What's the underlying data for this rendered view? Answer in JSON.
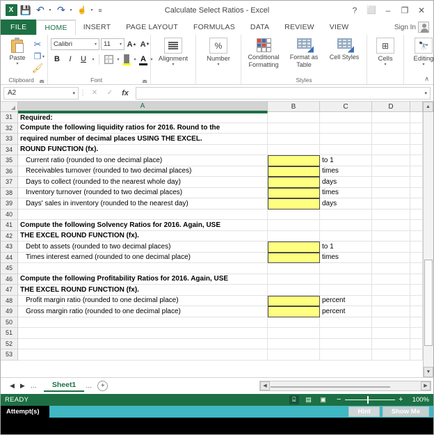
{
  "window": {
    "title": "Calculate Select Ratios - Excel",
    "quick_access": [
      {
        "name": "excel-logo",
        "glyph": "X"
      },
      {
        "name": "save-icon",
        "glyph": "💾"
      },
      {
        "name": "undo-icon",
        "glyph": "↶"
      },
      {
        "name": "redo-icon",
        "glyph": "↷"
      },
      {
        "name": "touch-mode-icon",
        "glyph": "☝"
      },
      {
        "name": "customize-qat-icon",
        "glyph": "≡"
      }
    ],
    "controls": {
      "help": "?",
      "ribbon_display": "⬜",
      "minimize": "–",
      "restore": "❐",
      "close": "✕"
    },
    "sign_in": "Sign In"
  },
  "tabs": {
    "file": "FILE",
    "items": [
      "HOME",
      "INSERT",
      "PAGE LAYOUT",
      "FORMULAS",
      "DATA",
      "REVIEW",
      "VIEW"
    ],
    "active": "HOME"
  },
  "ribbon": {
    "clipboard": {
      "group_label": "Clipboard",
      "paste": "Paste",
      "cut_icon": "✂",
      "copy_icon": "❐",
      "format_painter_icon": "🖌"
    },
    "font": {
      "group_label": "Font",
      "font_name": "Calibri",
      "font_size": "11",
      "grow_font": "A",
      "shrink_font": "A",
      "bold": "B",
      "italic": "I",
      "underline": "U",
      "fill_color_letter": "🎨",
      "font_color_letter": "A",
      "fill_color_hex": "#ffff00",
      "font_color_hex": "#111111"
    },
    "alignment": {
      "label": "Alignment"
    },
    "number": {
      "label": "Number",
      "glyph": "%"
    },
    "styles": {
      "group_label": "Styles",
      "conditional_formatting": "Conditional Formatting",
      "format_as_table": "Format as Table",
      "cell_styles": "Cell Styles"
    },
    "cells": {
      "label": "Cells",
      "glyph": "⊞"
    },
    "editing": {
      "label": "Editing",
      "glyph": "🔭"
    },
    "collapse": "∧"
  },
  "formula_bar": {
    "name_box_value": "A2",
    "cancel_icon": "✕",
    "enter_icon": "✓",
    "insert_function_icon": "fx",
    "formula_value": "",
    "formula_placeholder": ""
  },
  "grid": {
    "columns": [
      {
        "label": "A",
        "selected": true
      },
      {
        "label": "B",
        "selected": false
      },
      {
        "label": "C",
        "selected": false
      },
      {
        "label": "D",
        "selected": false
      }
    ],
    "rows": [
      {
        "n": "31",
        "a": "Required:",
        "bold": true,
        "indent": false,
        "b": "",
        "c": "",
        "yellow": false
      },
      {
        "n": "32",
        "a": "Compute the following liquidity ratios for 2016. Round to the",
        "bold": true,
        "indent": false,
        "b": "",
        "c": "",
        "yellow": false
      },
      {
        "n": "33",
        "a": "required number of decimal places USING THE EXCEL.",
        "bold": true,
        "indent": false,
        "b": "",
        "c": "",
        "yellow": false
      },
      {
        "n": "34",
        "a": "ROUND FUNCTION (fx).",
        "bold": true,
        "indent": false,
        "b": "",
        "c": "",
        "yellow": false
      },
      {
        "n": "35",
        "a": "Current ratio (rounded to one decimal place)",
        "bold": false,
        "indent": true,
        "b": "",
        "c": "to 1",
        "yellow": true
      },
      {
        "n": "36",
        "a": "Receivables turnover (rounded to two decimal places)",
        "bold": false,
        "indent": true,
        "b": "",
        "c": "times",
        "yellow": true
      },
      {
        "n": "37",
        "a": "Days to collect (rounded to the nearest whole day)",
        "bold": false,
        "indent": true,
        "b": "",
        "c": "days",
        "yellow": true
      },
      {
        "n": "38",
        "a": "Inventory turnover (rounded to two decimal places)",
        "bold": false,
        "indent": true,
        "b": "",
        "c": "times",
        "yellow": true
      },
      {
        "n": "39",
        "a": "Days' sales in inventory (rounded to the nearest day)",
        "bold": false,
        "indent": true,
        "b": "",
        "c": "days",
        "yellow": true
      },
      {
        "n": "40",
        "a": "",
        "bold": false,
        "indent": false,
        "b": "",
        "c": "",
        "yellow": false
      },
      {
        "n": "41",
        "a": "Compute the following Solvency Ratios for 2016. Again, USE",
        "bold": true,
        "indent": false,
        "b": "",
        "c": "",
        "yellow": false
      },
      {
        "n": "42",
        "a": "THE EXCEL ROUND FUNCTION (fx).",
        "bold": true,
        "indent": false,
        "b": "",
        "c": "",
        "yellow": false
      },
      {
        "n": "43",
        "a": "Debt to assets (rounded to two decimal places)",
        "bold": false,
        "indent": true,
        "b": "",
        "c": "to 1",
        "yellow": true
      },
      {
        "n": "44",
        "a": "Times interest earned (rounded to one decimal place)",
        "bold": false,
        "indent": true,
        "b": "",
        "c": "times",
        "yellow": true
      },
      {
        "n": "45",
        "a": "",
        "bold": false,
        "indent": false,
        "b": "",
        "c": "",
        "yellow": false
      },
      {
        "n": "46",
        "a": "Compute the following Profitability Ratios for 2016. Again, USE",
        "bold": true,
        "indent": false,
        "b": "",
        "c": "",
        "yellow": false
      },
      {
        "n": "47",
        "a": "THE EXCEL ROUND FUNCTION (fx).",
        "bold": true,
        "indent": false,
        "b": "",
        "c": "",
        "yellow": false
      },
      {
        "n": "48",
        "a": "Profit margin ratio (rounded to one decimal place)",
        "bold": false,
        "indent": true,
        "b": "",
        "c": "percent",
        "yellow": true
      },
      {
        "n": "49",
        "a": "Gross margin ratio (rounded to one decimal place)",
        "bold": false,
        "indent": true,
        "b": "",
        "c": "percent",
        "yellow": true
      },
      {
        "n": "50",
        "a": "",
        "bold": false,
        "indent": false,
        "b": "",
        "c": "",
        "yellow": false
      },
      {
        "n": "51",
        "a": "",
        "bold": false,
        "indent": false,
        "b": "",
        "c": "",
        "yellow": false
      },
      {
        "n": "52",
        "a": "",
        "bold": false,
        "indent": false,
        "b": "",
        "c": "",
        "yellow": false
      },
      {
        "n": "53",
        "a": "",
        "bold": false,
        "indent": false,
        "b": "",
        "c": "",
        "yellow": false
      }
    ]
  },
  "sheet_bar": {
    "first_icon": "◀",
    "last_icon": "▶",
    "left_dots": "…",
    "right_dots": "…",
    "sheet_name": "Sheet1",
    "add_sheet": "⊕"
  },
  "status_bar": {
    "ready": "READY",
    "view_normal_icon": "⌸",
    "view_layout_icon": "▤",
    "view_pagebreak_icon": "▣",
    "zoom_out": "−",
    "zoom_in": "+",
    "zoom_level": "100%",
    "accent_hex": "#1d7044"
  },
  "attempt_bar": {
    "label": "Attempt(s)",
    "hint_button": "Hint",
    "show_me_button": "Show Me",
    "bar_hex": "#3fb8c4"
  }
}
